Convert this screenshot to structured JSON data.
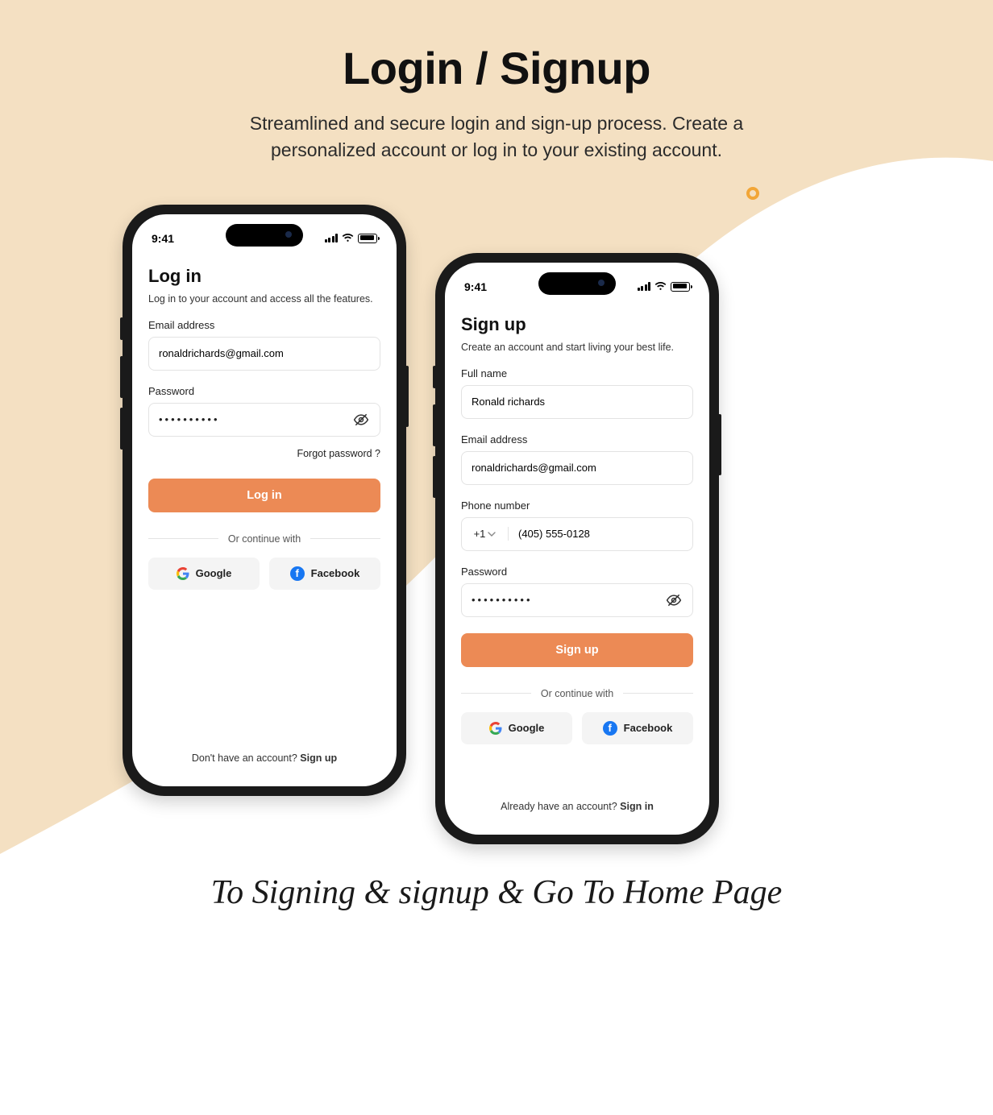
{
  "header": {
    "title": "Login / Signup",
    "subtitle_l1": "Streamlined and secure login and sign-up process. Create a",
    "subtitle_l2": "personalized account or log in to your existing account."
  },
  "status": {
    "time": "9:41"
  },
  "login": {
    "title": "Log in",
    "subtitle": "Log in to your account and access all the features.",
    "email_label": "Email address",
    "email_value": "ronaldrichards@gmail.com",
    "password_label": "Password",
    "password_value": "••••••••••",
    "forgot": "Forgot password ?",
    "submit": "Log in",
    "divider": "Or continue with",
    "google": "Google",
    "facebook": "Facebook",
    "footer_text": "Don't have an account? ",
    "footer_link": "Sign up"
  },
  "signup": {
    "title": "Sign up",
    "subtitle": "Create an account and start living your best life.",
    "name_label": "Full name",
    "name_value": "Ronald richards",
    "email_label": "Email address",
    "email_value": "ronaldrichards@gmail.com",
    "phone_label": "Phone number",
    "phone_cc": "+1",
    "phone_value": "(405) 555-0128",
    "password_label": "Password",
    "password_value": "••••••••••",
    "submit": "Sign up",
    "divider": "Or continue with",
    "google": "Google",
    "facebook": "Facebook",
    "footer_text": "Already have an account? ",
    "footer_link": "Sign in"
  },
  "caption": "To Signing & signup & Go To Home Page"
}
